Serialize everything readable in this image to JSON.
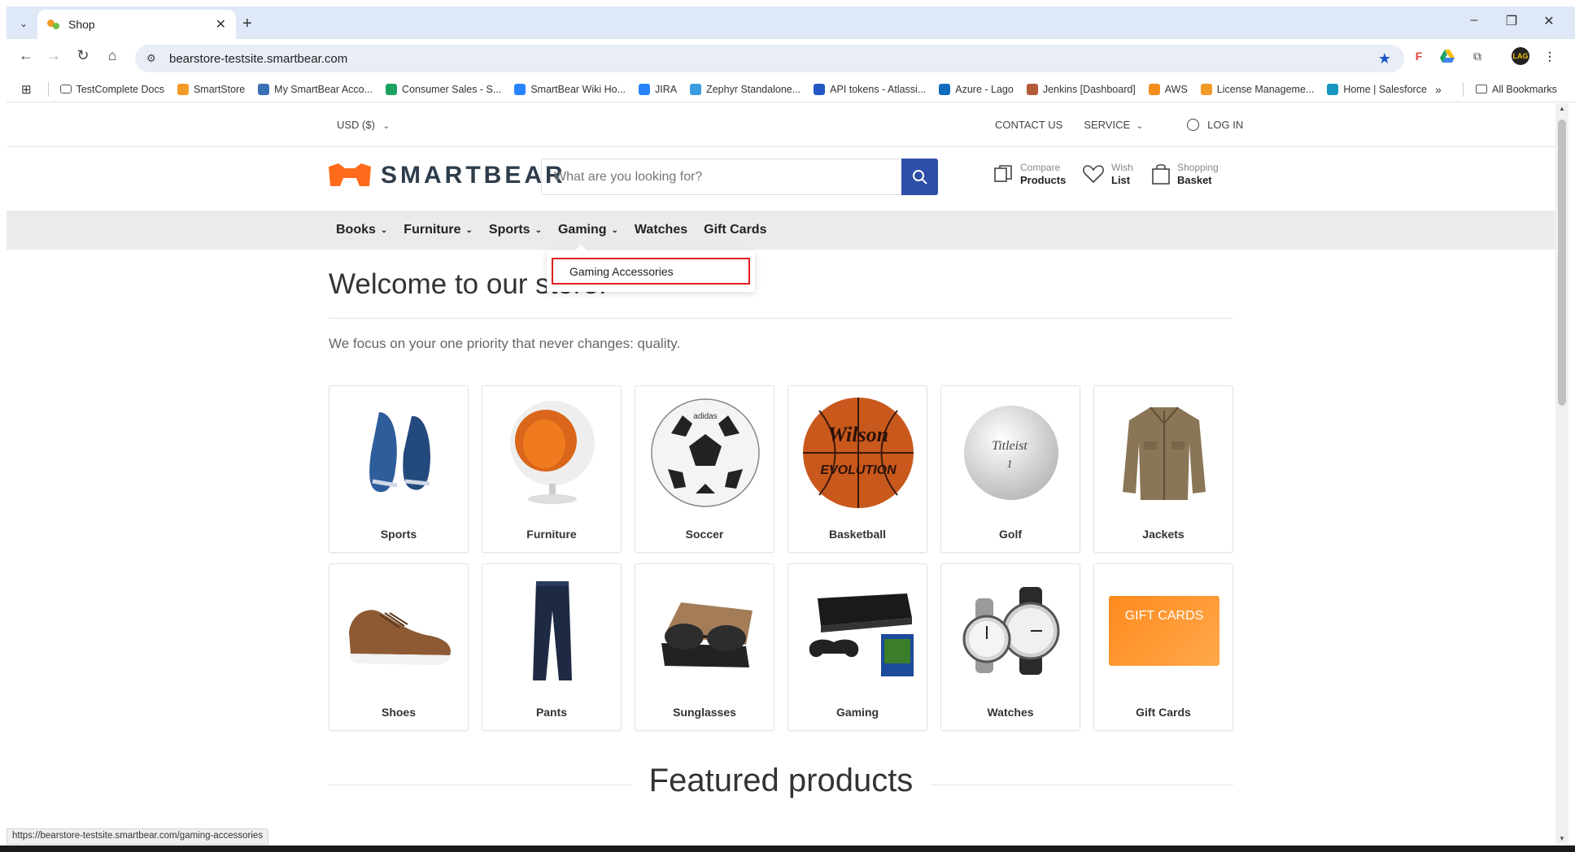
{
  "browser": {
    "tab_title": "Shop",
    "url": "bearstore-testsite.smartbear.com",
    "status_url": "https://bearstore-testsite.smartbear.com/gaming-accessories",
    "bookmarks": [
      {
        "label": "TestComplete Docs",
        "color": "#555555"
      },
      {
        "label": "SmartStore",
        "color": "#f29a27"
      },
      {
        "label": "My SmartBear Acco...",
        "color": "#3b6fb6"
      },
      {
        "label": "Consumer Sales - S...",
        "color": "#1aa260"
      },
      {
        "label": "SmartBear Wiki Ho...",
        "color": "#2684ff"
      },
      {
        "label": "JIRA",
        "color": "#2684ff"
      },
      {
        "label": "Zephyr Standalone...",
        "color": "#3b9be0"
      },
      {
        "label": "API tokens - Atlassi...",
        "color": "#2457c5"
      },
      {
        "label": "Azure - Lago",
        "color": "#0f6cbd"
      },
      {
        "label": "Jenkins [Dashboard]",
        "color": "#b35a3a"
      },
      {
        "label": "AWS",
        "color": "#f28c1d"
      },
      {
        "label": "License Manageme...",
        "color": "#f29a27"
      },
      {
        "label": "Home | Salesforce",
        "color": "#1798c1"
      }
    ],
    "all_bookmarks": "All Bookmarks",
    "more": "»"
  },
  "topbar": {
    "currency": "USD  ($)",
    "contact": "CONTACT US",
    "service": "SERVICE",
    "login": "LOG IN"
  },
  "header": {
    "logo_text": "SMARTBEAR",
    "search_placeholder": "What are you looking for?",
    "compare_small": "Compare",
    "compare_big": "Products",
    "wish_small": "Wish",
    "wish_big": "List",
    "basket_small": "Shopping",
    "basket_big": "Basket"
  },
  "menu": {
    "items": [
      "Books",
      "Furniture",
      "Sports",
      "Gaming",
      "Watches",
      "Gift Cards"
    ],
    "dropdown_item": "Gaming Accessories"
  },
  "main": {
    "welcome": "Welcome to our store!",
    "tagline": "We focus on your one priority that never changes: quality.",
    "categories": [
      "Sports",
      "Furniture",
      "Soccer",
      "Basketball",
      "Golf",
      "Jackets",
      "Shoes",
      "Pants",
      "Sunglasses",
      "Gaming",
      "Watches",
      "Gift Cards"
    ],
    "featured": "Featured products",
    "giftcard_text": "GIFT CARDS",
    "basketball_brand": "Wilson",
    "basketball_model": "EVOLUTION",
    "golf_brand": "Titleist"
  },
  "colors": {
    "accent": "#2e4fa8",
    "logo_orange": "#ff6b1a",
    "highlight_border": "#e01e1e"
  }
}
